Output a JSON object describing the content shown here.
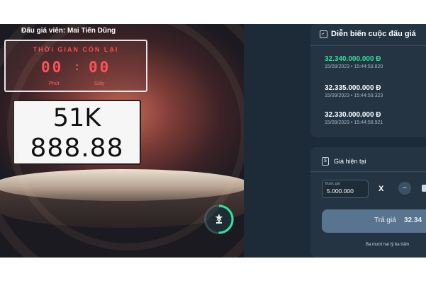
{
  "stage": {
    "auctioneer": "Đấu giá viên: Mai Tiến Dũng",
    "timer": {
      "title": "THỜI GIAN CÒN LẠI",
      "minutes": "00",
      "seconds": "00",
      "minutes_unit": "Phút",
      "seconds_unit": "Giây"
    },
    "plate": {
      "line1": "51K",
      "line2": "888.88"
    }
  },
  "history": {
    "title": "Diễn biến cuộc đấu giá",
    "bids": [
      {
        "amount": "32.340.000.000 Đ",
        "time": "15/09/2023 • 15:44:59.820"
      },
      {
        "amount": "32.335.000.000 Đ",
        "time": "15/09/2023 • 15:44:59.323"
      },
      {
        "amount": "32.330.000.000 Đ",
        "time": "15/09/2023 • 15:44:58.921"
      }
    ]
  },
  "current": {
    "title": "Giá hiện tại",
    "step_label": "Bước giá",
    "step_value": "5.000.000",
    "times": "X",
    "minus": "−",
    "bid_label": "Trả giá",
    "bid_value": "32.34",
    "amount_words": "Ba mươi hai tỷ ba trăm"
  },
  "colors": {
    "leading_bid": "#2fe39a",
    "timer": "#ff5252",
    "panel": "#243442"
  }
}
